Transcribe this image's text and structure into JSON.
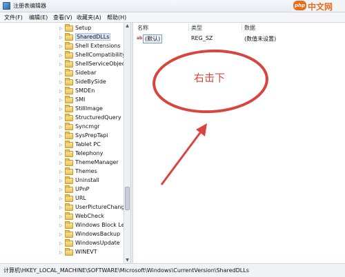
{
  "window": {
    "title": "注册表编辑器"
  },
  "watermark": {
    "badge": "php",
    "text": "中文网"
  },
  "menu": [
    "文件(F)",
    "编辑(E)",
    "查看(V)",
    "收藏夹(A)",
    "帮助(H)"
  ],
  "tree": {
    "items": [
      {
        "label": "Setup"
      },
      {
        "label": "SharedDLLs",
        "selected": true
      },
      {
        "label": "Shell Extensions"
      },
      {
        "label": "ShellCompatibility"
      },
      {
        "label": "ShellServiceObjecti"
      },
      {
        "label": "Sidebar"
      },
      {
        "label": "SideBySide"
      },
      {
        "label": "SMDEn"
      },
      {
        "label": "SMI"
      },
      {
        "label": "StillImage"
      },
      {
        "label": "StructuredQuery"
      },
      {
        "label": "Syncmgr"
      },
      {
        "label": "SysPrepTapi"
      },
      {
        "label": "Tablet PC"
      },
      {
        "label": "Telephony"
      },
      {
        "label": "ThemeManager"
      },
      {
        "label": "Themes"
      },
      {
        "label": "Uninstall"
      },
      {
        "label": "UPnP"
      },
      {
        "label": "URL"
      },
      {
        "label": "UserPictureChange"
      },
      {
        "label": "WebCheck"
      },
      {
        "label": "Windows Block Le"
      },
      {
        "label": "WindowsBackup"
      },
      {
        "label": "WindowsUpdate"
      },
      {
        "label": "WINEVT"
      }
    ]
  },
  "list": {
    "headers": {
      "name": "名称",
      "type": "类型",
      "data": "数据"
    },
    "rows": [
      {
        "name": "(默认)",
        "type": "REG_SZ",
        "data": "(数值未设置)"
      }
    ]
  },
  "annotation": {
    "text": "右击下",
    "color": "#d8453e"
  },
  "status": {
    "path": "计算机\\HKEY_LOCAL_MACHINE\\SOFTWARE\\Microsoft\\Windows\\CurrentVersion\\SharedDLLs"
  }
}
